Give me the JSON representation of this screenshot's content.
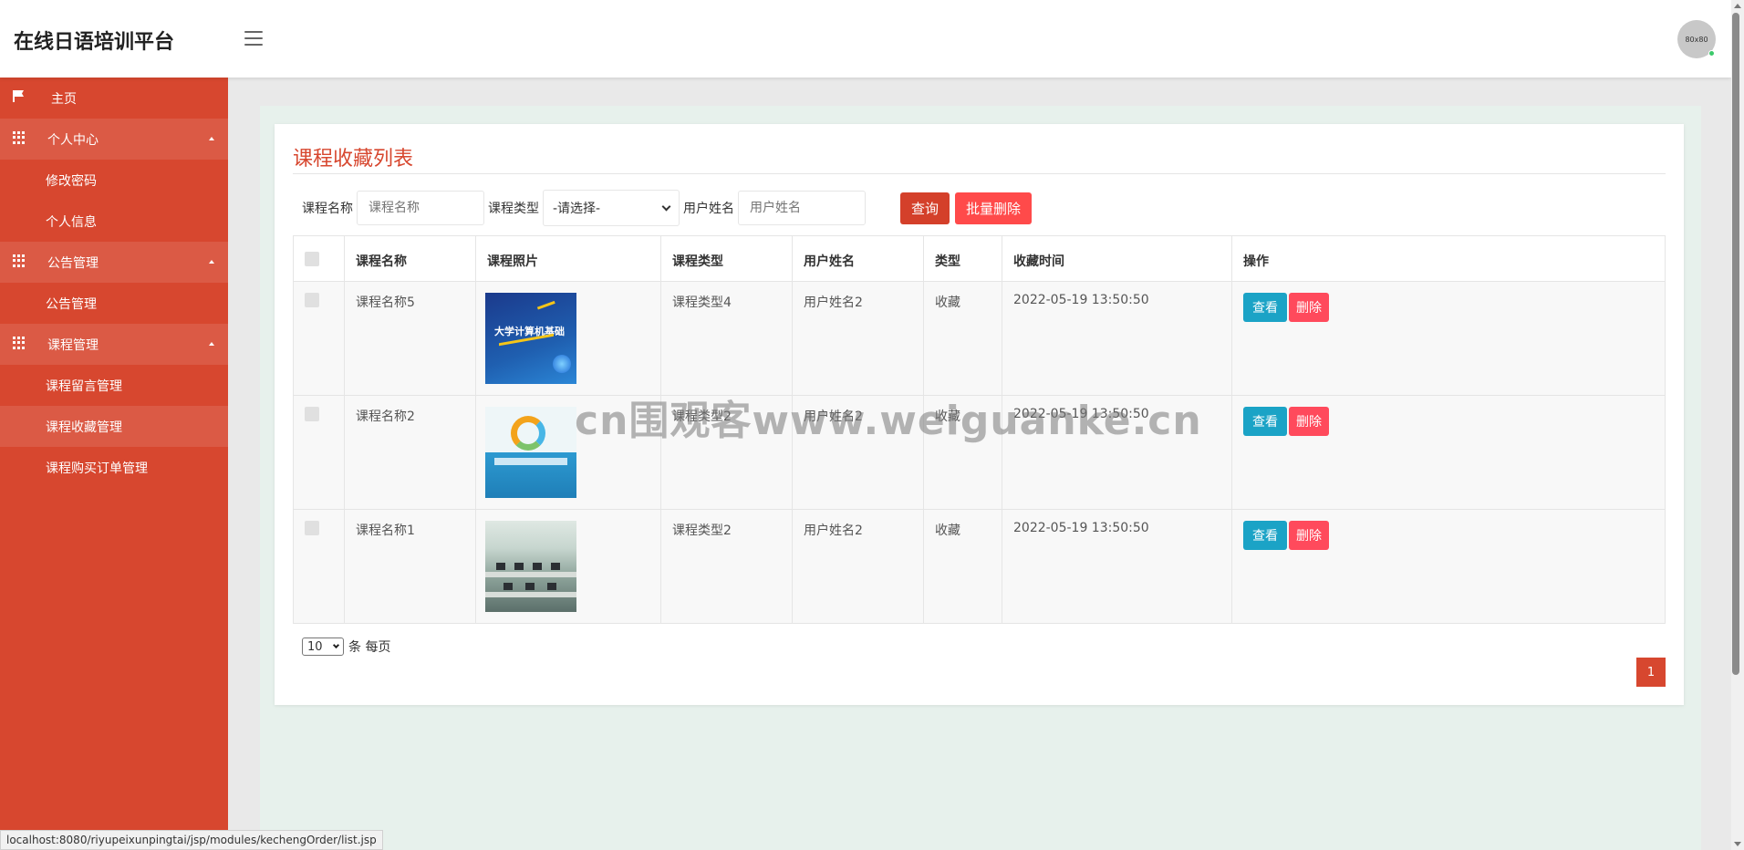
{
  "brand": "在线日语培训平台",
  "avatar": {
    "text": "80x80"
  },
  "sidebar": {
    "home": "主页",
    "groups": [
      {
        "label": "个人中心",
        "items": [
          "修改密码",
          "个人信息"
        ]
      },
      {
        "label": "公告管理",
        "items": [
          "公告管理"
        ]
      },
      {
        "label": "课程管理",
        "items": [
          "课程留言管理",
          "课程收藏管理",
          "课程购买订单管理"
        ]
      }
    ]
  },
  "panel": {
    "title": "课程收藏列表",
    "filters": {
      "course_name_label": "课程名称",
      "course_name_placeholder": "课程名称",
      "course_type_label": "课程类型",
      "course_type_value": "-请选择-",
      "user_name_label": "用户姓名",
      "user_name_placeholder": "用户姓名",
      "query_button": "查询",
      "batch_delete_button": "批量删除"
    },
    "table": {
      "headers": [
        "课程名称",
        "课程照片",
        "课程类型",
        "用户姓名",
        "类型",
        "收藏时间",
        "操作"
      ],
      "rows": [
        {
          "course_name": "课程名称5",
          "course_type": "课程类型4",
          "user_name": "用户姓名2",
          "type": "收藏",
          "time": "2022-05-19 13:50:50",
          "photo": "book-cover-computer-basics",
          "cover_title": "大学计算机基础"
        },
        {
          "course_name": "课程名称2",
          "course_type": "课程类型2",
          "user_name": "用户姓名2",
          "type": "收藏",
          "time": "2022-05-19 13:50:50",
          "photo": "book-cover-blue"
        },
        {
          "course_name": "课程名称1",
          "course_type": "课程类型2",
          "user_name": "用户姓名2",
          "type": "收藏",
          "time": "2022-05-19 13:50:50",
          "photo": "computer-lab-photo"
        }
      ],
      "view_label": "查看",
      "delete_label": "删除"
    },
    "pagination": {
      "page_size": "10",
      "page_size_suffix": "条 每页",
      "current_page": "1"
    }
  },
  "watermark": "cn围观客www.weiguanke.cn",
  "statusbar": "localhost:8080/riyupeixunpingtai/jsp/modules/kechengOrder/list.jsp",
  "colors": {
    "primary": "#d7472f",
    "sidebar_group": "#db5a45",
    "view_button": "#1ba3c6",
    "delete_button": "#ff4a5c",
    "content_bg": "#e7f1ec"
  }
}
